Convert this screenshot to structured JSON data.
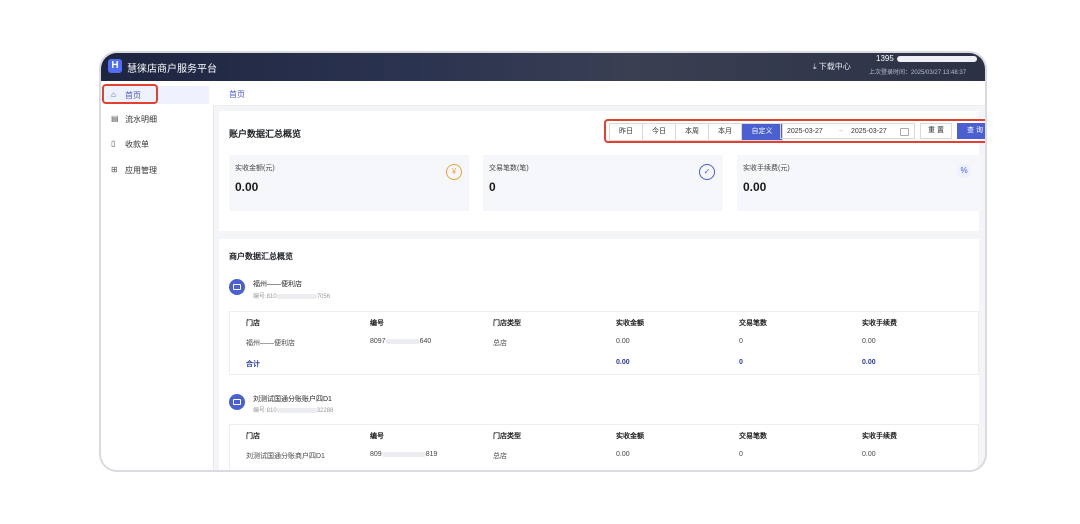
{
  "app": {
    "title": "慧徕店商户服务平台",
    "download_center": "下载中心",
    "user_phone": "1395",
    "last_login": "上次登录时间：2025/03/27 13:48:37"
  },
  "sidebar": {
    "items": [
      {
        "label": "首页",
        "icon": "home-icon",
        "active": true
      },
      {
        "label": "流水明细",
        "icon": "calendar-icon"
      },
      {
        "label": "收款单",
        "icon": "receipt-icon"
      },
      {
        "label": "应用管理",
        "icon": "apps-grid-icon"
      }
    ]
  },
  "breadcrumb": "首页",
  "account_summary": {
    "title": "账户数据汇总概览",
    "range_buttons": [
      "昨日",
      "今日",
      "本周",
      "本月",
      "自定义"
    ],
    "active_range": "自定义",
    "date_start": "2025-03-27",
    "date_sep": "→",
    "date_end": "2025-03-27",
    "reset_label": "重 置",
    "query_label": "查 询",
    "stats": [
      {
        "label": "实收金额(元)",
        "value": "0.00",
        "icon": "yuan-icon",
        "icon_color": "#f0a23a"
      },
      {
        "label": "交易笔数(笔)",
        "value": "0",
        "icon": "check-circle-icon",
        "icon_color": "#4a5fd0"
      },
      {
        "label": "实收手续费(元)",
        "value": "0.00",
        "icon": "percent-icon",
        "icon_color": "#4a5fd0"
      }
    ]
  },
  "merchant_summary": {
    "title": "商户数据汇总概览",
    "columns": [
      "门店",
      "编号",
      "门店类型",
      "实收金额",
      "交易笔数",
      "实收手续费"
    ],
    "merchants": [
      {
        "name": "福州——便利店",
        "id_prefix": "编号:810",
        "id_suffix": "7056",
        "rows": [
          [
            "福州——便利店",
            "8097",
            "640",
            "总店",
            "0.00",
            "0",
            "0.00"
          ]
        ],
        "total": [
          "合计",
          "0.00",
          "0",
          "0.00"
        ]
      },
      {
        "name": "刘测试国通分账账户四D1",
        "id_prefix": "编号:810",
        "id_suffix": "32288",
        "rows": [
          [
            "刘测试国通分账商户四D1",
            "809",
            "819",
            "总店",
            "0.00",
            "0",
            "0.00"
          ]
        ]
      }
    ]
  },
  "colors": {
    "accent": "#4a5fd0",
    "highlight": "#e3412f",
    "topbar": "#1d2540"
  }
}
